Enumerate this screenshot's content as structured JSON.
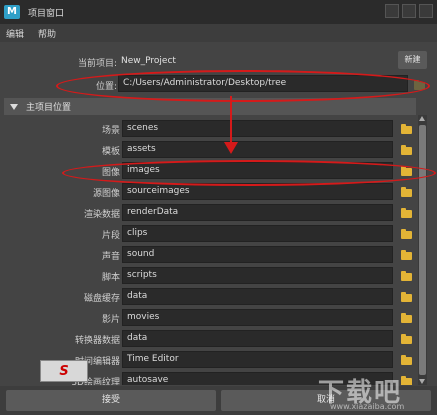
{
  "window": {
    "title": "项目窗口",
    "app_icon": "M"
  },
  "menu": {
    "items": [
      "编辑",
      "帮助"
    ]
  },
  "top": {
    "current_label": "当前项目:",
    "current_value": "New_Project",
    "new_button": "新建",
    "location_label": "位置:",
    "location_value": "C:/Users/Administrator/Desktop/tree"
  },
  "section": {
    "title": "主项目位置"
  },
  "rows": [
    {
      "label": "场景",
      "value": "scenes"
    },
    {
      "label": "模板",
      "value": "assets"
    },
    {
      "label": "图像",
      "value": "images"
    },
    {
      "label": "源图像",
      "value": "sourceimages"
    },
    {
      "label": "渲染数据",
      "value": "renderData"
    },
    {
      "label": "片段",
      "value": "clips"
    },
    {
      "label": "声音",
      "value": "sound"
    },
    {
      "label": "脚本",
      "value": "scripts"
    },
    {
      "label": "磁盘缓存",
      "value": "data"
    },
    {
      "label": "影片",
      "value": "movies"
    },
    {
      "label": "转换器数据",
      "value": "data"
    },
    {
      "label": "时间编辑器",
      "value": "Time Editor"
    },
    {
      "label": "3D绘画纹理",
      "value": "autosave"
    }
  ],
  "buttons": {
    "accept": "接受",
    "cancel": "取消"
  },
  "overlays": {
    "logo_text": "S",
    "watermark": "下载吧",
    "watermark_sub": "www.xiazaiba.com"
  },
  "colors": {
    "annotation": "#d51a1a",
    "folder": "#e3b436",
    "accent": "#2fa0c8"
  }
}
